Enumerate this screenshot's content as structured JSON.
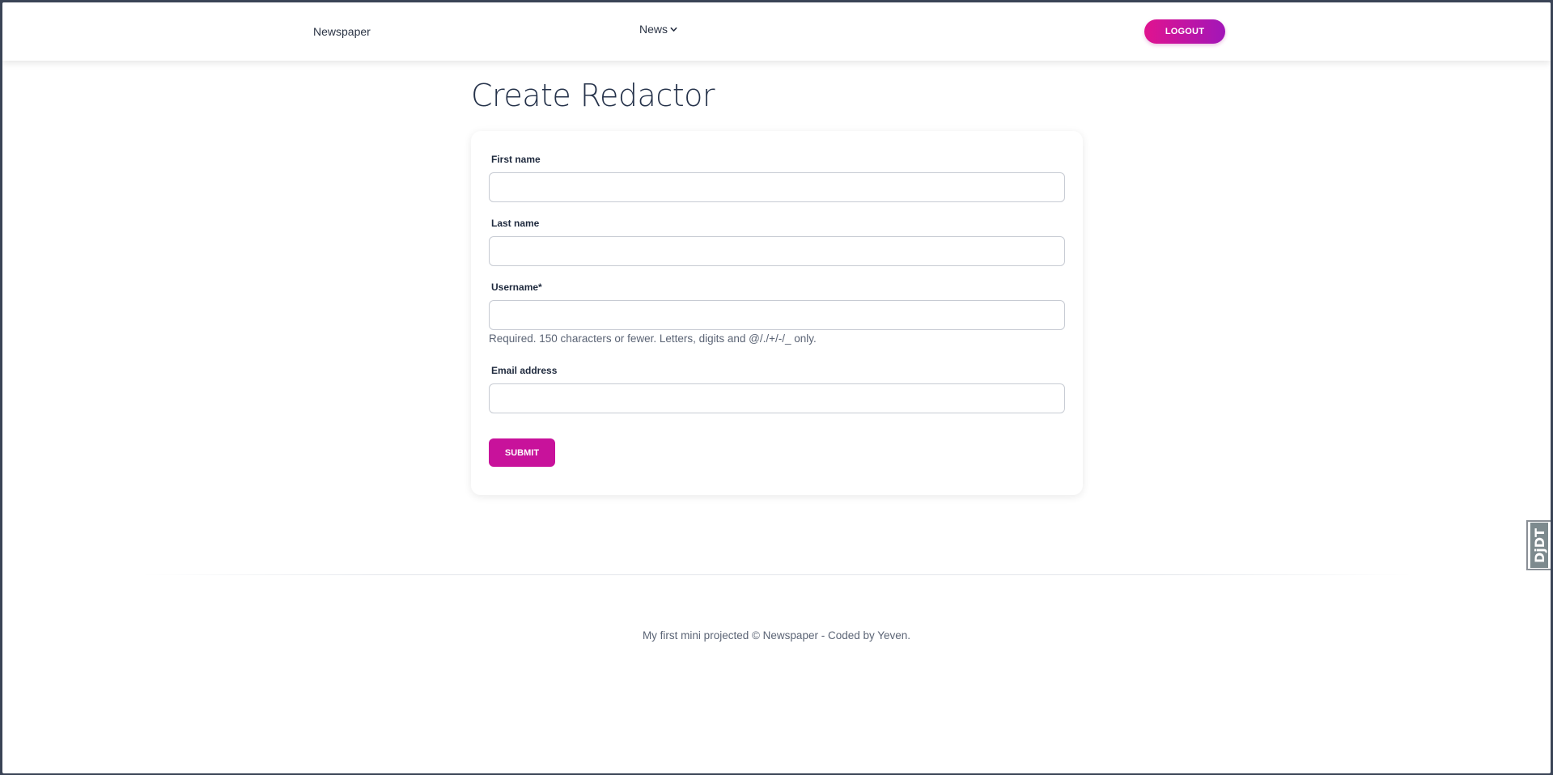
{
  "navbar": {
    "brand": "Newspaper",
    "news_menu_label": "News",
    "logout_label": "LOGOUT"
  },
  "page": {
    "title": "Create Redactor"
  },
  "form": {
    "fields": [
      {
        "label": "First name",
        "value": ""
      },
      {
        "label": "Last name",
        "value": ""
      },
      {
        "label": "Username*",
        "value": "",
        "help_text": "Required. 150 characters or fewer. Letters, digits and @/./+/-/_ only."
      },
      {
        "label": "Email address",
        "value": ""
      }
    ],
    "submit_label": "SUBMIT"
  },
  "footer": {
    "text": "My first mini projected © Newspaper - Coded by Yeven."
  },
  "debug_toolbar": {
    "label": "DjDT"
  },
  "colors": {
    "accent": "#c8129b",
    "logout_gradient_start": "#e0138f",
    "logout_gradient_end": "#a216b8",
    "heading": "#25324a",
    "muted_text": "#5b6475",
    "window_frame": "#3a4456"
  },
  "icons": {
    "news_dropdown": "chevron-down-icon"
  }
}
